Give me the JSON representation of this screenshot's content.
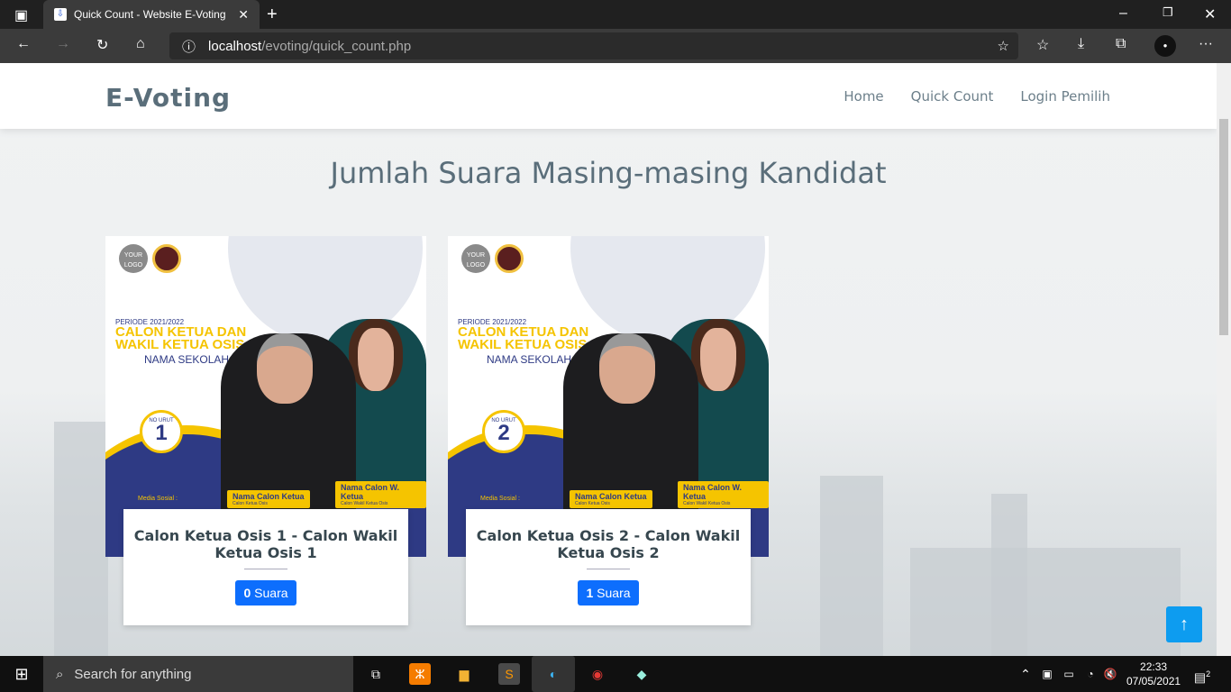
{
  "browser": {
    "tab_title": "Quick Count - Website E-Voting",
    "url_host": "localhost",
    "url_path": "/evoting/quick_count.php"
  },
  "nav": {
    "brand": "E-Voting",
    "items": [
      "Home",
      "Quick Count",
      "Login Pemilih"
    ]
  },
  "page_title": "Jumlah Suara Masing-masing Kandidat",
  "poster": {
    "logo": "YOUR LOGO",
    "periode": "PERIODE 2021/2022",
    "headline1": "CALON KETUA DAN",
    "headline2": "WAKIL KETUA OSIS",
    "school": "NAMA SEKOLAH",
    "no_urut": "NO URUT",
    "ketua": "Nama Calon Ketua",
    "ketua_sub": "Calon Ketua Osis",
    "wakil": "Nama Calon W. Ketua",
    "wakil_sub": "Calon Wakil Ketua Osis",
    "media": "Media Sosial :"
  },
  "candidates": [
    {
      "number": "1",
      "name": "Calon Ketua Osis 1 - Calon Wakil Ketua Osis 1",
      "votes": "0",
      "votes_label": "Suara"
    },
    {
      "number": "2",
      "name": "Calon Ketua Osis 2 - Calon Wakil Ketua Osis 2",
      "votes": "1",
      "votes_label": "Suara"
    }
  ],
  "colors": {
    "accent": "#0d6efd",
    "poster_blue": "#2e3a84",
    "poster_yellow": "#f5c400"
  },
  "taskbar": {
    "search_placeholder": "Search for anything",
    "time": "22:33",
    "date": "07/05/2021",
    "notifications": "2"
  }
}
